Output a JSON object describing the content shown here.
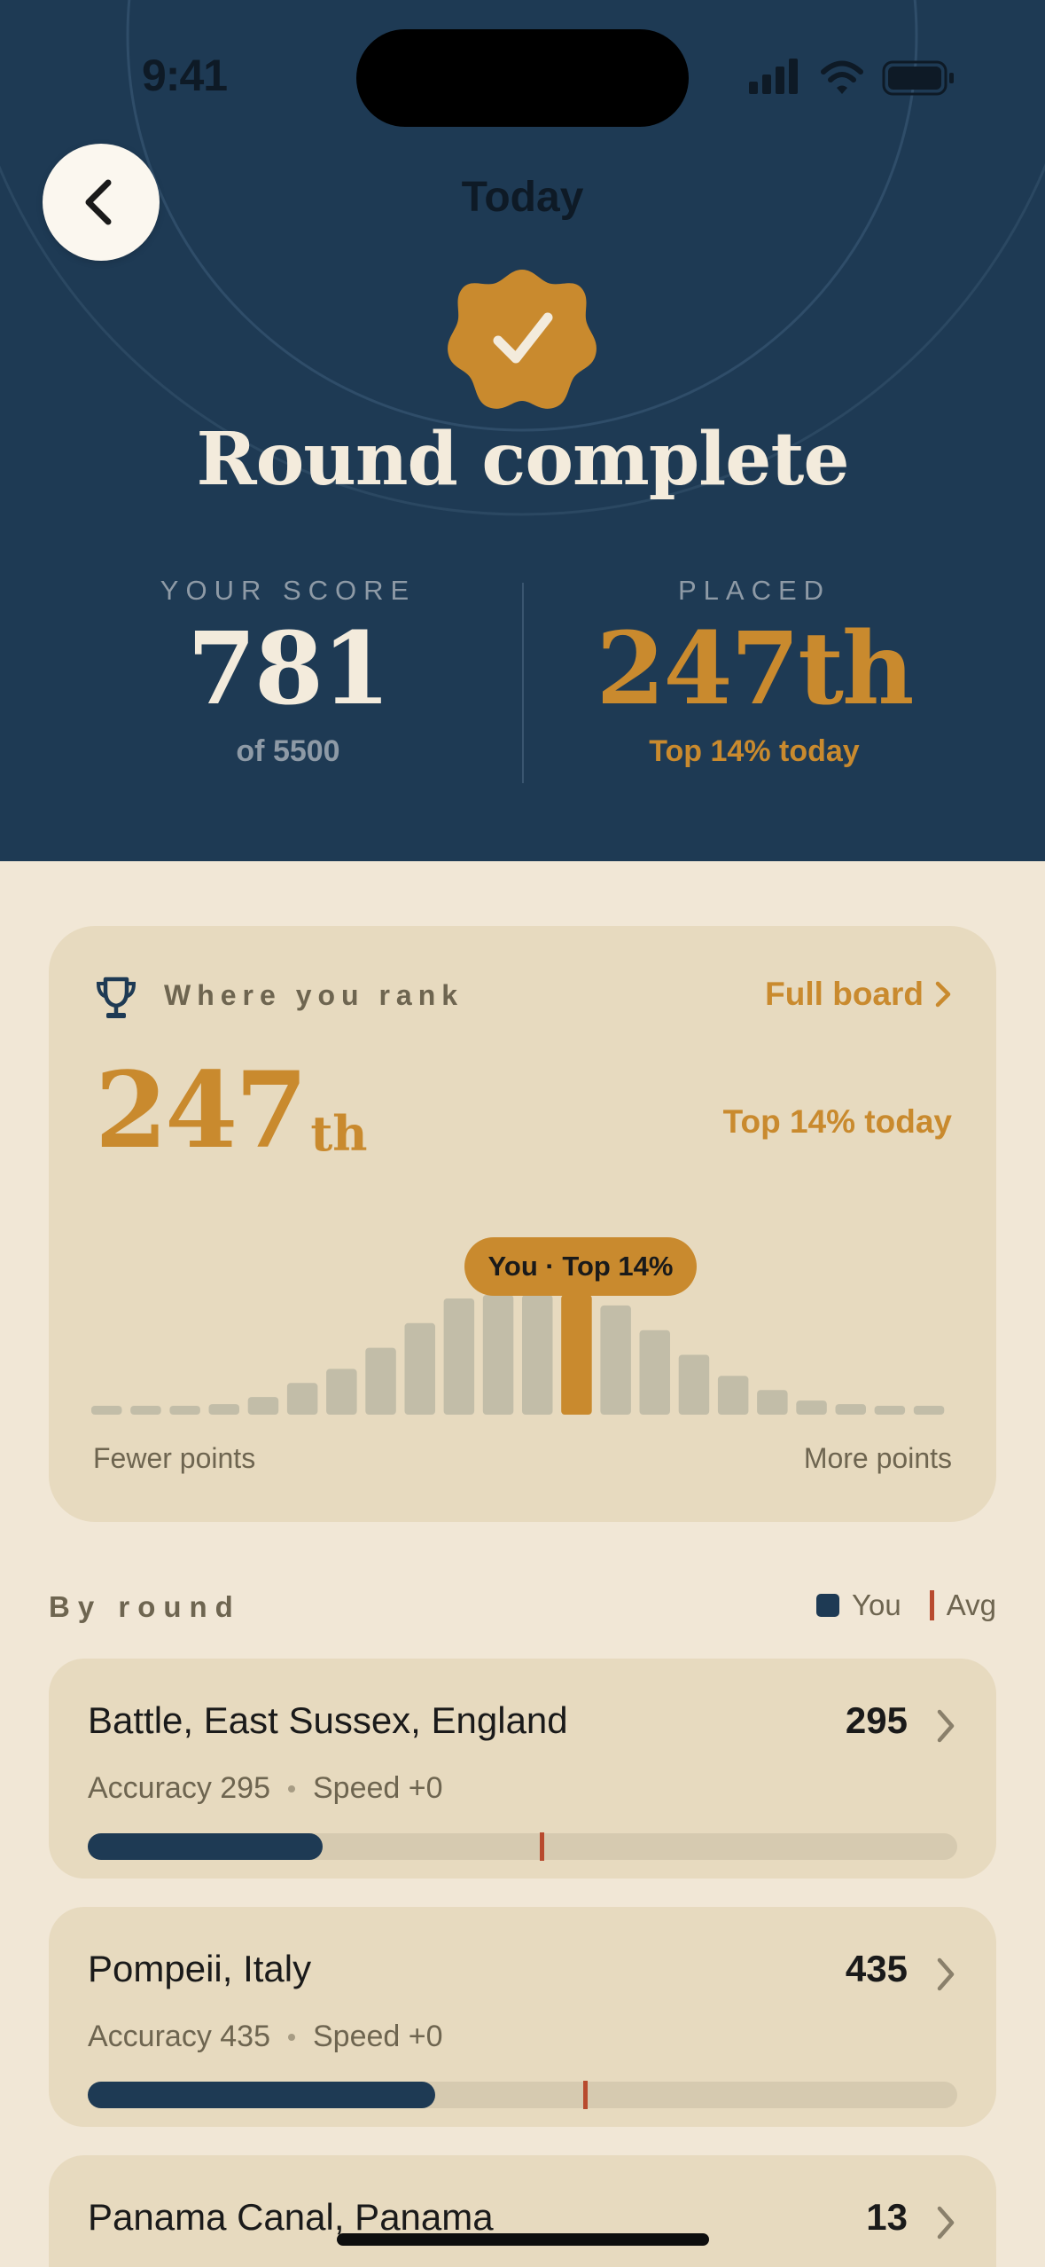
{
  "status_bar": {
    "time": "9:41",
    "icons": [
      "signal-icon",
      "wifi-icon",
      "battery-icon"
    ]
  },
  "header": {
    "tab_label": "Today",
    "title": "Round complete",
    "badge_icon": "checkmark-badge-icon",
    "score": {
      "label": "YOUR SCORE",
      "value": "781",
      "sub": "of 5500"
    },
    "placed": {
      "label": "PLACED",
      "value": "247th",
      "sub": "Top 14% today"
    }
  },
  "rank_card": {
    "label": "Where you rank",
    "link_label": "Full board",
    "rank_number": "247",
    "rank_suffix": "th",
    "top_text": "Top 14% today",
    "you_marker": "You · Top 14%",
    "axis_left": "Fewer points",
    "axis_right": "More points",
    "distribution": [
      1,
      1,
      1,
      1.5,
      2.5,
      4.5,
      6.5,
      9.5,
      13,
      16.5,
      17,
      17,
      17,
      15.5,
      12,
      8.5,
      5.5,
      3.5,
      2,
      1.5,
      1,
      1
    ],
    "you_bucket_index": 12
  },
  "by_round": {
    "label": "By round",
    "legend": {
      "you": "You",
      "avg": "Avg"
    },
    "rounds": [
      {
        "name": "Battle, East Sussex, England",
        "score": "295",
        "accuracy": "Accuracy 295",
        "speed": "Speed +0",
        "you_fraction": 0.27,
        "avg_fraction": 0.52
      },
      {
        "name": "Pompeii, Italy",
        "score": "435",
        "accuracy": "Accuracy 435",
        "speed": "Speed +0",
        "you_fraction": 0.4,
        "avg_fraction": 0.57
      },
      {
        "name": "Panama Canal, Panama",
        "score": "13"
      }
    ]
  },
  "colors": {
    "navy": "#1E3A54",
    "gold": "#C98A2E",
    "cream": "#F1E7D6",
    "card": "#E7DABF",
    "avg_red": "#B84A2E"
  }
}
